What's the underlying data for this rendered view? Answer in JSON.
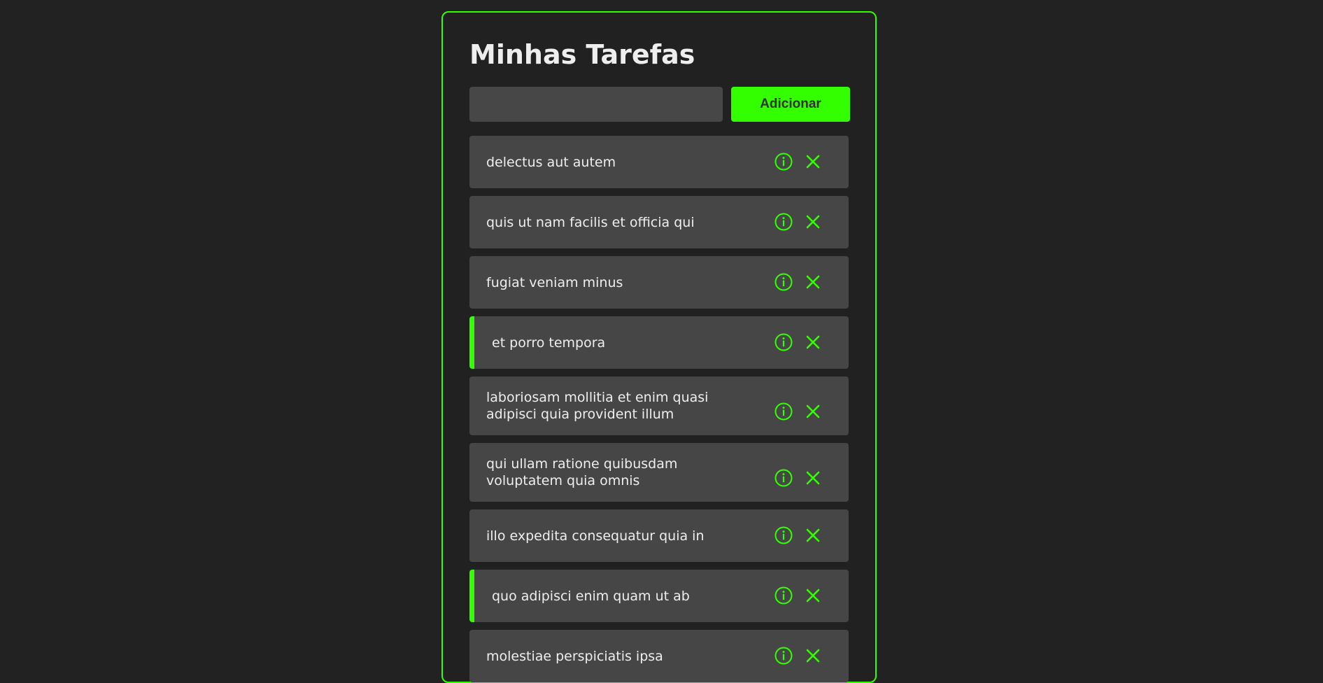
{
  "app": {
    "title": "Minhas Tarefas",
    "accent_color": "#33ff00",
    "background_color": "#222222",
    "card_color": "#464646"
  },
  "form": {
    "input_value": "",
    "input_placeholder": "",
    "add_label": "Adicionar"
  },
  "tasks": [
    {
      "text": "delectus aut autem",
      "completed": false
    },
    {
      "text": "quis ut nam facilis et officia qui",
      "completed": false
    },
    {
      "text": "fugiat veniam minus",
      "completed": false
    },
    {
      "text": "et porro tempora",
      "completed": true
    },
    {
      "text": "laboriosam mollitia et enim quasi adipisci quia provident illum",
      "completed": false
    },
    {
      "text": "qui ullam ratione quibusdam voluptatem quia omnis",
      "completed": false
    },
    {
      "text": "illo expedita consequatur quia in",
      "completed": false
    },
    {
      "text": "quo adipisci enim quam ut ab",
      "completed": true
    },
    {
      "text": "molestiae perspiciatis ipsa",
      "completed": false
    }
  ],
  "task_icons": {
    "details": "info-circle-icon",
    "delete": "close-icon"
  }
}
